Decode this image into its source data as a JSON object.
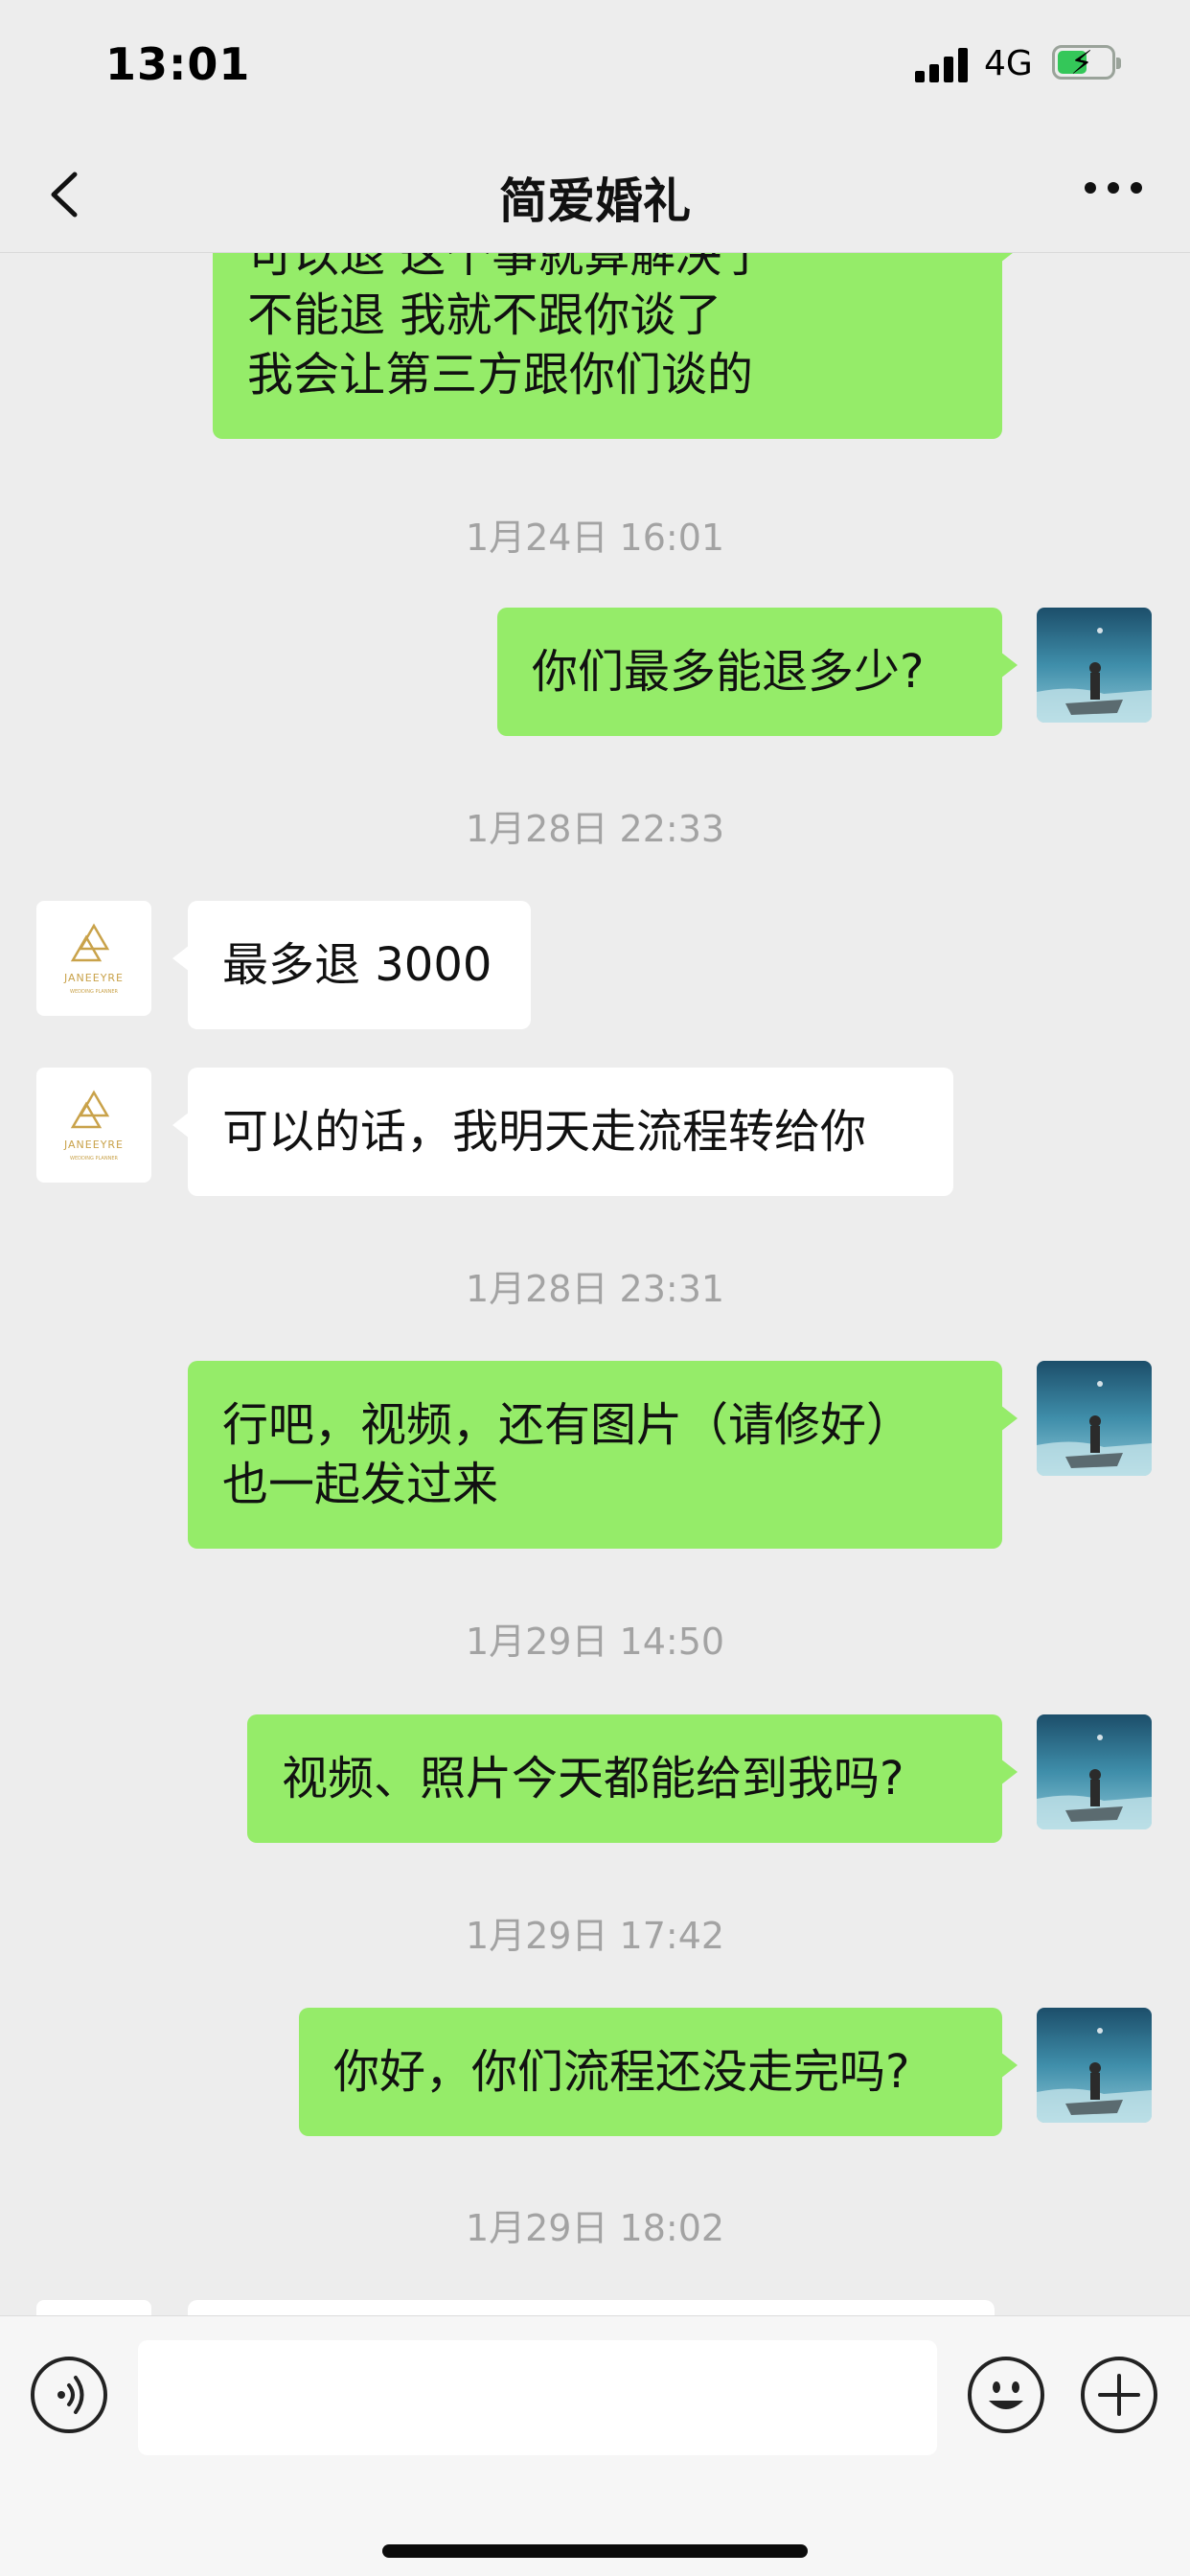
{
  "status_bar": {
    "time": "13:01",
    "network": "4G"
  },
  "nav": {
    "title": "简爱婚礼"
  },
  "messages": [
    {
      "from": "me",
      "text": "可以退 这个事就算解决了\n不能退 我就不跟你谈了\n我会让第三方跟你们谈的"
    },
    {
      "time": "1月24日 16:01"
    },
    {
      "from": "me",
      "text": "你们最多能退多少?"
    },
    {
      "time": "1月28日 22:33"
    },
    {
      "from": "other",
      "text": "最多退 3000"
    },
    {
      "from": "other",
      "text": "可以的话，我明天走流程转给你"
    },
    {
      "time": "1月28日 23:31"
    },
    {
      "from": "me",
      "text": "行吧，视频，还有图片（请修好）\n也一起发过来"
    },
    {
      "time": "1月29日 14:50"
    },
    {
      "from": "me",
      "text": "视频、照片今天都能给到我吗?"
    },
    {
      "time": "1月29日 17:42"
    },
    {
      "from": "me",
      "text": "你好，你们流程还没走完吗?"
    },
    {
      "time": "1月29日 18:02"
    }
  ],
  "brand_avatar": {
    "name": "JANEEYRE",
    "tagline": "WEDDING PLANNER",
    "color": "#c9a24a"
  },
  "colors": {
    "me_bubble": "#95ec69",
    "other_bubble": "#ffffff",
    "background": "#ededed"
  },
  "icons": [
    "back-icon",
    "more-icon",
    "voice-icon",
    "emoji-icon",
    "plus-icon"
  ]
}
